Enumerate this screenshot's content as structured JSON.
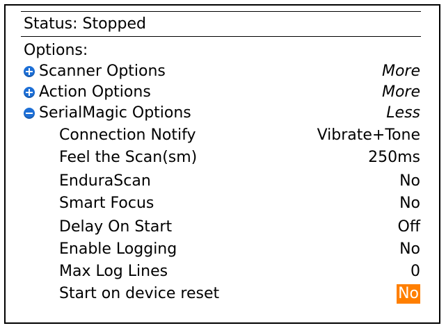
{
  "status": {
    "label": "Status: Stopped"
  },
  "options": {
    "heading": "Options:",
    "sections": [
      {
        "label": "Scanner Options",
        "value": "More",
        "icon": "plus-circle-icon"
      },
      {
        "label": "Action Options",
        "value": "More",
        "icon": "plus-circle-icon"
      },
      {
        "label": "SerialMagic Options",
        "value": "Less",
        "icon": "minus-circle-icon"
      }
    ],
    "settings": [
      {
        "label": "Connection Notify",
        "value": "Vibrate+Tone"
      },
      {
        "label": "Feel the Scan(sm)",
        "value": "250ms"
      },
      {
        "label": "EnduraScan",
        "value": "No"
      },
      {
        "label": "Smart Focus",
        "value": "No"
      },
      {
        "label": "Delay On Start",
        "value": "Off"
      },
      {
        "label": "Enable Logging",
        "value": "No"
      },
      {
        "label": "Max Log Lines",
        "value": "0"
      },
      {
        "label": "Start on device reset",
        "value": "No"
      }
    ]
  },
  "colors": {
    "accent_icon": "#1d6fd6",
    "selection_highlight": "#ff7f00"
  }
}
